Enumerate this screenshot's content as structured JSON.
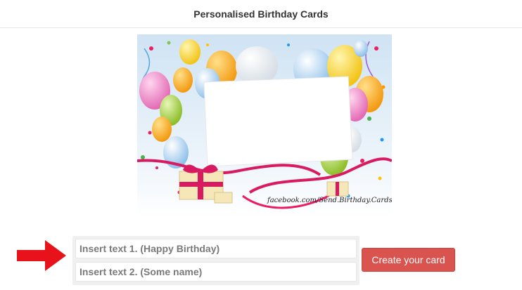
{
  "header": {
    "title": "Personalised Birthday Cards"
  },
  "card": {
    "watermark": "facebook.com/Send.Birthday.Cards"
  },
  "form": {
    "input1_placeholder": "Insert text 1. (Happy Birthday)",
    "input2_placeholder": "Insert text 2. (Some name)",
    "submit_label": "Create your card"
  },
  "colors": {
    "button": "#d9534f",
    "arrow": "#e8121b",
    "ribbon": "#d81b60"
  },
  "icons": {
    "arrow": "arrow-right-icon"
  }
}
